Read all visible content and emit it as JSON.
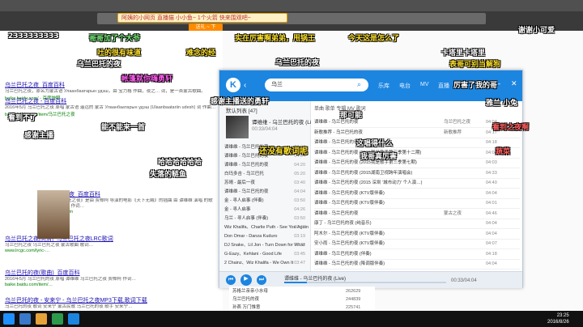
{
  "browser": {
    "banner_text": "阿姨的小网页 直播猫  小小鱼~  1个火箭 快来围观吧~",
    "banner_button": "送礼 ~ 下"
  },
  "search": {
    "results": [
      {
        "title": "乌兰巴托之夜_百度百科",
        "text": "乌兰巴托之夜，原名为蒙古语 Улаанбаатарын удэш，由 宝力格 作曲，夜之…  词，是一首蒙古歌曲。",
        "url": "baike.baidu.com/ - 百度快照"
      },
      {
        "title": "乌兰巴托之夜 - 百度百科",
        "text": "2016年5月 乌兰巴托之夜 原唱 蒙古语 遥远的 蒙古 Улаанбаатарын удэш (Ulaanbaatariin udesh) 词 作曲…",
        "url": "baike.baidu.com/item/乌兰巴托之夜"
      },
      {
        "title": "乌兰巴托之夜_百度百科",
        "text": "歌曲《乌兰巴托之夜》是由 贾樟柯 导演的电影《天下无贼》的插曲 由 谭维维 演唱 的歌曲 作曲 宝力格 作词…",
        "url": "baike.baidu.com"
      },
      {
        "title": "乌兰巴托之夜[高清]_乌兰巴托之夜LRC歌词",
        "text": "乌兰巴托之夜 乌兰巴托之夜 蒙古歌曲 歌词…",
        "url": "www.lrcgc.com/lyric-…"
      },
      {
        "title": "乌兰巴托的夜(歌曲)_百度百科",
        "text": "2016年5月 乌兰巴托的夜 原唱 谭维维 乌兰巴托之夜 贾樟柯 作词…",
        "url": "baike.baidu.com/item/…"
      },
      {
        "title": "乌兰巴托的夜 - 安来宁 - 乌兰巴托之夜MP3下载,歌词下载",
        "text": "乌兰巴托的夜 歌词 安来宁 蒙古民歌 乌兰巴托的夜 歌手 安来宁…",
        "url": "music.baidu.com/ - 百度快照"
      }
    ]
  },
  "player": {
    "logo": "K",
    "search_value": "乌兰",
    "tabs": [
      "乐库",
      "电台",
      "MV",
      "直播"
    ],
    "sidebar_title": "默认列表 [47]",
    "now_playing_title": "谭维维 - 乌兰巴托的夜 (Live)",
    "now_playing_time": "00:33/04:04",
    "sidebar_songs": [
      {
        "name": "谭维维 - 乌兰巴托的夜",
        "dur": "04:04"
      },
      {
        "name": "谭维维 - 乌兰巴托的夜",
        "dur": "04:04"
      },
      {
        "name": "谭维维 - 乌兰巴托的夜",
        "dur": "04:20"
      },
      {
        "name": "白玛多吉 - 乌兰巴托",
        "dur": "05:20"
      },
      {
        "name": "苏晴 - 最后一夜",
        "dur": "03:40"
      },
      {
        "name": "谭维维 - 乌兰巴托的夜",
        "dur": "04:04"
      },
      {
        "name": "金 - 寻人启事 (伴奏)",
        "dur": "03:50"
      },
      {
        "name": "金 - 寻人启事",
        "dur": "04:26"
      },
      {
        "name": "乌兰 - 寻人启事 (伴奏)",
        "dur": "03:50"
      },
      {
        "name": "Wiz Khalifa、Charlie Puth - See You Again",
        "dur": "03:49"
      },
      {
        "name": "Don Omar - Danza Kuduro",
        "dur": "03:19"
      },
      {
        "name": "DJ Snake、Lil Jon - Turn Down for What",
        "dur": "03:33"
      },
      {
        "name": "G-Eazy、Kehlani - Good Life",
        "dur": "03:45"
      },
      {
        "name": "2 Chainz、Wiz Khalifa - We Own It",
        "dur": "03:47"
      }
    ],
    "main_tabs": "单曲  歌单  专辑  MV  歌词",
    "main_rows": [
      {
        "name": "谭维维 - 乌兰巴托的夜",
        "album": "乌兰巴托之夜",
        "dur": "04:04"
      },
      {
        "name": "新歌推荐 - 乌兰巴托的夜",
        "album": "新歌推荐",
        "dur": "04:17"
      },
      {
        "name": "谭维维 - 乌兰巴托的夜",
        "album": "",
        "dur": "04:18"
      },
      {
        "name": "谭维维 - 乌兰巴托的夜 (2015我是歌手第三季第十二期)",
        "album": "",
        "dur": "04:04"
      },
      {
        "name": "谭维维 - 乌兰巴托的夜 (2015我是歌手第三季第七期)",
        "album": "",
        "dur": "04:03"
      },
      {
        "name": "谭维维 - 乌兰巴托的夜 (2015湖南卫视跨年演唱会)",
        "album": "",
        "dur": "04:33"
      },
      {
        "name": "谭维维 - 乌兰巴托的夜 (2015 深圳 '城市动力' 个人演…)",
        "album": "",
        "dur": "04:40"
      },
      {
        "name": "谭维维 - 乌兰巴托的夜 (KTV版伴奏)",
        "album": "",
        "dur": "04:04"
      },
      {
        "name": "谭维维 - 乌兰巴托的夜 (KTV版伴奏)",
        "album": "",
        "dur": "04:01"
      },
      {
        "name": "谭维维 - 乌兰巴托的夜",
        "album": "蒙古之夜",
        "dur": "04:46"
      },
      {
        "name": "康丁 - 乌兰巴托的夜 (纯音乐)",
        "album": "",
        "dur": "04:04"
      },
      {
        "name": "阿木尔 - 乌兰巴托的夜 (KTV版伴奏)",
        "album": "",
        "dur": "04:04"
      },
      {
        "name": "安小雨 - 乌兰巴托的夜 (KTV版伴奏)",
        "album": "",
        "dur": "04:07"
      },
      {
        "name": "谭维维 - 乌兰巴托的夜 (伴奏)",
        "album": "",
        "dur": "04:18"
      },
      {
        "name": "谭维维 - 乌兰巴托的夜 (降调版伴奏)",
        "album": "",
        "dur": "04:04"
      }
    ],
    "bar_song": "谭维维 - 乌兰巴托的夜 (Live)",
    "bar_time": "00:33/04:04",
    "progress": 0.14
  },
  "bottom_list": [
    {
      "name": "苏格兰亲亲小水母",
      "num": "262629"
    },
    {
      "name": "乌兰巴托的夜",
      "num": "244839"
    },
    {
      "name": "孙燕 万门惟意",
      "num": "225741"
    }
  ],
  "taskbar": {
    "time": "23:25",
    "date": "2016/8/26"
  },
  "danmaku": [
    {
      "text": "今天这是怎么了",
      "color": "#ffe22d",
      "size": 9
    },
    {
      "text": "实在厉害啊弟弟，甩锅王",
      "color": "#ffe22d",
      "size": 9
    },
    {
      "text": "2333333333",
      "color": "#ffffff",
      "size": 9
    },
    {
      "text": "哥哥加了个大爷",
      "color": "#7cf07c",
      "size": 9
    },
    {
      "text": "吐的很有味道",
      "color": "#ffe22d",
      "size": 9
    },
    {
      "text": "难念的经",
      "color": "#ffe22d",
      "size": 9
    },
    {
      "text": "卡塔里卡塔里",
      "color": "#ffffff",
      "size": 9
    },
    {
      "text": "乌兰巴托的夜",
      "color": "#ffffff",
      "size": 9
    },
    {
      "text": "表哥可别当解狗",
      "color": "#ffe22d",
      "size": 9
    },
    {
      "text": "帐篷就你嗨勇轩",
      "color": "#ff5cf0",
      "size": 9
    },
    {
      "text": "还没有歌词呢",
      "color": "#ffe22d",
      "size": 10
    },
    {
      "text": "能不能来一首",
      "color": "#ffffff",
      "size": 9
    },
    {
      "text": "哈哈哈哈哈哈",
      "color": "#ffffff",
      "size": 9
    },
    {
      "text": "失落的鲢鱼",
      "color": "#ffffff",
      "size": 9
    },
    {
      "text": "看到之夜啊",
      "color": "#ff6060",
      "size": 9
    },
    {
      "text": "蔬菜",
      "color": "#ff6060",
      "size": 9
    },
    {
      "text": "乌兰巴托的夜",
      "color": "#ffffff",
      "size": 9
    },
    {
      "text": "感谢主播送的勇轩",
      "color": "#ffffff",
      "size": 9
    },
    {
      "text": "那可能",
      "color": "#ffffff",
      "size": 9
    },
    {
      "text": "这唱得什么",
      "color": "#ffffff",
      "size": 9
    },
    {
      "text": "我哥真厉害",
      "color": "#ffffff",
      "size": 9
    },
    {
      "text": "雅兰 小兔",
      "color": "#ffffff",
      "size": 9
    },
    {
      "text": "感谢主播",
      "color": "#ffffff",
      "size": 9
    },
    {
      "text": "厉害了我的哥",
      "color": "#ffffff",
      "size": 9
    },
    {
      "text": "谢谢小可爱",
      "color": "#ffffff",
      "size": 9
    },
    {
      "text": "看到不了",
      "color": "#ffffff",
      "size": 9
    }
  ]
}
